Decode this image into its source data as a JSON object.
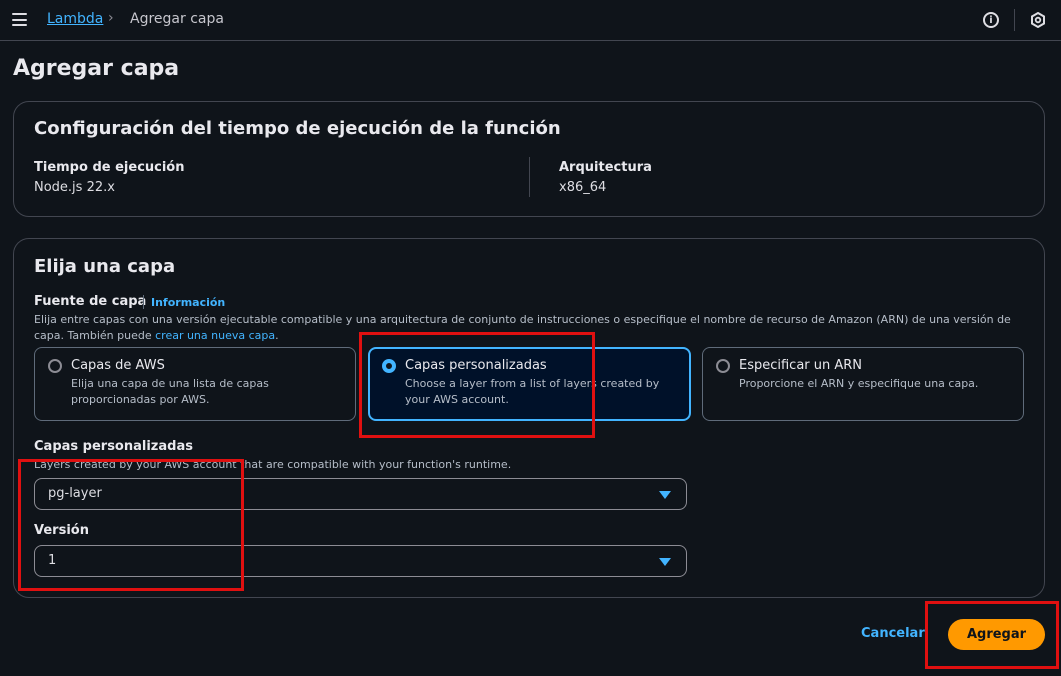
{
  "breadcrumb": {
    "root": "Lambda",
    "separator": "›",
    "current": "Agregar capa"
  },
  "topbar": {
    "info_icon": "info-icon",
    "settings_icon": "settings-icon"
  },
  "page_title": "Agregar capa",
  "runtime_panel": {
    "title": "Configuración del tiempo de ejecución de la función",
    "runtime_label": "Tiempo de ejecución",
    "runtime_value": "Node.js 22.x",
    "arch_label": "Arquitectura",
    "arch_value": "x86_64"
  },
  "layer_panel": {
    "title": "Elija una capa",
    "source_label": "Fuente de capa",
    "info_link": "Información",
    "description": "Elija entre capas con una versión ejecutable compatible y una arquitectura de conjunto de instrucciones o especifique el nombre de recurso de Amazon (ARN) de una versión de capa. También puede",
    "create_link": "crear una nueva capa",
    "create_link_suffix": ".",
    "options": [
      {
        "title": "Capas de AWS",
        "description": "Elija una capa de una lista de capas proporcionadas por AWS.",
        "selected": false
      },
      {
        "title": "Capas personalizadas",
        "description": "Choose a layer from a list of layers created by your AWS account.",
        "selected": true
      },
      {
        "title": "Especificar un ARN",
        "description": "Proporcione el ARN y especifique una capa.",
        "selected": false
      }
    ],
    "custom_layers_label": "Capas personalizadas",
    "custom_layers_desc": "Layers created by your AWS account that are compatible with your function's runtime.",
    "custom_layers_value": "pg-layer",
    "version_label": "Versión",
    "version_value": "1"
  },
  "actions": {
    "cancel": "Cancelar",
    "add": "Agregar"
  },
  "colors": {
    "background": "#0f141a",
    "accent": "#42b4ff",
    "primary_button": "#ff9900",
    "annotation": "#e01010"
  }
}
